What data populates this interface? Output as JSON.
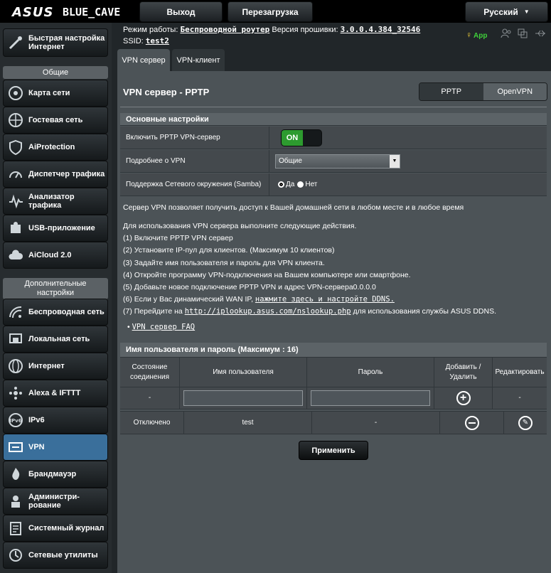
{
  "header": {
    "logo": "ASUS",
    "model": "BLUE_CAVE",
    "logout": "Выход",
    "reboot": "Перезагрузка",
    "language": "Русский"
  },
  "info": {
    "mode_label": "Режим работы:",
    "mode_value": "Беспроводной роутер",
    "fw_label": "Версия прошивки:",
    "fw_value": "3.0.0.4.384_32546",
    "ssid_label": "SSID:",
    "ssid_value": "test2",
    "app_label": "App"
  },
  "sidebar": {
    "quick": "Быстрая настройка Интернет",
    "general_header": "Общие",
    "general": [
      "Карта сети",
      "Гостевая сеть",
      "AiProtection",
      "Диспетчер трафика",
      "Анализатор трафика",
      "USB-приложение",
      "AiCloud 2.0"
    ],
    "advanced_header": "Дополнительные настройки",
    "advanced": [
      "Беспроводная сеть",
      "Локальная сеть",
      "Интернет",
      "Alexa & IFTTT",
      "IPv6",
      "VPN",
      "Брандмауэр",
      "Администри-рование",
      "Системный журнал",
      "Сетевые утилиты"
    ]
  },
  "tabs": {
    "server": "VPN сервер",
    "client": "VPN-клиент"
  },
  "main": {
    "title": "VPN сервер - PPTP",
    "seg_pptp": "PPTP",
    "seg_openvpn": "OpenVPN",
    "basic_header": "Основные настройки",
    "enable_label": "Включить PPTP VPN-сервер",
    "toggle_on": "ON",
    "details_label": "Подробнее о VPN",
    "details_value": "Общие",
    "samba_label": "Поддержка Сетевого окружения (Samba)",
    "samba_yes": "Да",
    "samba_no": "Нет",
    "intro": "Сервер VPN позволяет получить доступ к Вашей домашней сети в любом месте и в любое время",
    "steps_title": "Для использования VPN сервера выполните следующие действия.",
    "step1": "(1) Включите PPTP VPN сервер",
    "step2": "(2) Установите IP-пул для клиентов. (Максимум 10 клиентов)",
    "step3": "(3) Задайте имя пользователя и пароль для VPN клиента.",
    "step4": "(4) Откройте программу VPN-подключения на Вашем компьютере или смартфоне.",
    "step5": "(5) Добавьте новое подключение PPTP VPN и адрес VPN-сервера0.0.0.0",
    "step6_pre": "(6) Если у Вас динамический WAN IP, ",
    "step6_link": "нажмите здесь и настройте DDNS.",
    "step7_pre": "(7) Перейдите на ",
    "step7_link": "http://iplookup.asus.com/nslookup.php",
    "step7_post": " для использования службы ASUS DDNS.",
    "faq": "VPN сервер FAQ",
    "users_header": "Имя пользователя и пароль (Максимум : 16)",
    "col_state": "Состояние соединения",
    "col_user": "Имя пользователя",
    "col_pass": "Пароль",
    "col_add": "Добавить / Удалить",
    "col_edit": "Редактировать",
    "new_state": "-",
    "new_edit": "-",
    "row_state": "Отключено",
    "row_user": "test",
    "row_pass": "-",
    "apply": "Применить"
  }
}
